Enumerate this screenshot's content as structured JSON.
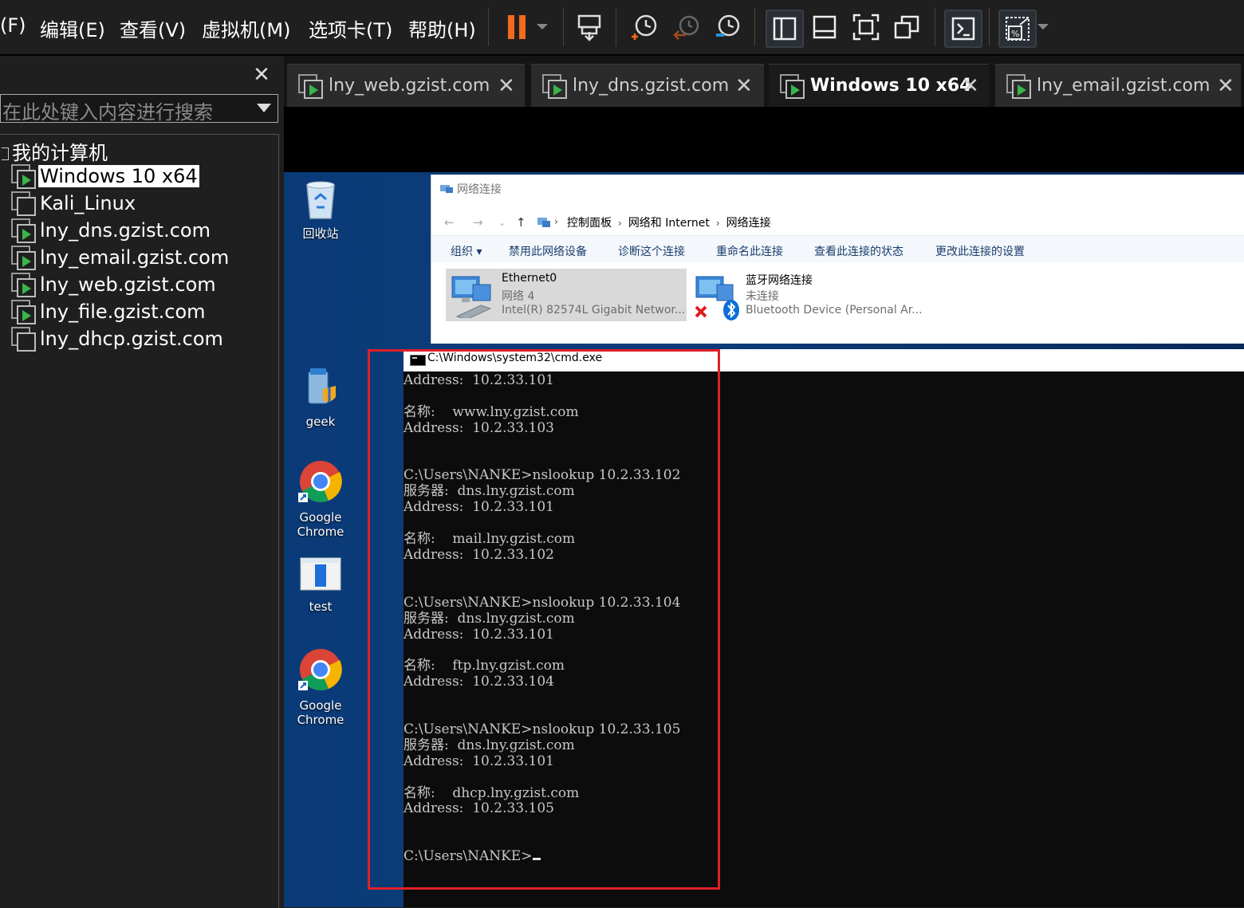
{
  "menubar": {
    "items": [
      "(F)",
      "编辑(E)",
      "查看(V)",
      "虚拟机(M)",
      "选项卡(T)",
      "帮助(H)"
    ],
    "toolbar_icons": [
      "pause-icon",
      "dropdown-arrow-icon",
      "send-ctrl-alt-del-icon",
      "snapshot-icon",
      "revert-snapshot-icon",
      "snapshot-manager-icon",
      "show-library-icon",
      "thumbnail-bar-icon",
      "fullscreen-icon",
      "unity-icon",
      "console-view-icon",
      "autofit-guest-icon",
      "dropdown-arrow-icon"
    ]
  },
  "library": {
    "search_placeholder": "在此处键入内容进行搜索",
    "root_label": "我的计算机",
    "items": [
      {
        "label": "Windows 10 x64",
        "running": true,
        "selected": true
      },
      {
        "label": "Kali_Linux",
        "running": false
      },
      {
        "label": "lny_dns.gzist.com",
        "running": true
      },
      {
        "label": "lny_email.gzist.com",
        "running": true
      },
      {
        "label": "lny_web.gzist.com",
        "running": true
      },
      {
        "label": "lny_file.gzist.com",
        "running": true
      },
      {
        "label": "lny_dhcp.gzist.com",
        "running": false
      }
    ]
  },
  "tabs": [
    {
      "label": "lny_web.gzist.com",
      "active": false
    },
    {
      "label": "lny_dns.gzist.com",
      "active": false
    },
    {
      "label": "Windows 10 x64",
      "active": true
    },
    {
      "label": "lny_email.gzist.com",
      "active": false
    }
  ],
  "desktop": {
    "icons": [
      {
        "label": "回收站",
        "icon": "recycle-bin-icon"
      },
      {
        "label": "geek",
        "icon": "geek-uninstaller-icon"
      },
      {
        "label": "Google Chrome",
        "icon": "chrome-icon"
      },
      {
        "label": "test",
        "icon": "text-file-icon"
      },
      {
        "label": "Google Chrome",
        "icon": "chrome-icon"
      }
    ]
  },
  "explorer": {
    "title": "网络连接",
    "breadcrumb": [
      "控制面板",
      "网络和 Internet",
      "网络连接"
    ],
    "toolbar": [
      "组织 ▾",
      "禁用此网络设备",
      "诊断这个连接",
      "重命名此连接",
      "查看此连接的状态",
      "更改此连接的设置"
    ],
    "connections": [
      {
        "name": "Ethernet0",
        "network": "网络 4",
        "device": "Intel(R) 82574L Gigabit Networ...",
        "selected": true
      },
      {
        "name": "蓝牙网络连接",
        "network": "未连接",
        "device": "Bluetooth Device (Personal Ar...",
        "selected": false
      }
    ]
  },
  "cmd": {
    "title": "C:\\Windows\\system32\\cmd.exe",
    "lines": [
      "Address:  10.2.33.101",
      "",
      "名称:    www.lny.gzist.com",
      "Address:  10.2.33.103",
      "",
      "",
      "C:\\Users\\NANKE>nslookup 10.2.33.102",
      "服务器:  dns.lny.gzist.com",
      "Address:  10.2.33.101",
      "",
      "名称:    mail.lny.gzist.com",
      "Address:  10.2.33.102",
      "",
      "",
      "C:\\Users\\NANKE>nslookup 10.2.33.104",
      "服务器:  dns.lny.gzist.com",
      "Address:  10.2.33.101",
      "",
      "名称:    ftp.lny.gzist.com",
      "Address:  10.2.33.104",
      "",
      "",
      "C:\\Users\\NANKE>nslookup 10.2.33.105",
      "服务器:  dns.lny.gzist.com",
      "Address:  10.2.33.101",
      "",
      "名称:    dhcp.lny.gzist.com",
      "Address:  10.2.33.105",
      "",
      "",
      "C:\\Users\\NANKE>"
    ]
  },
  "colors": {
    "highlight_box": "#e0202a",
    "pause_orange": "#f26b1d",
    "vm_running_green": "#39b54a"
  }
}
